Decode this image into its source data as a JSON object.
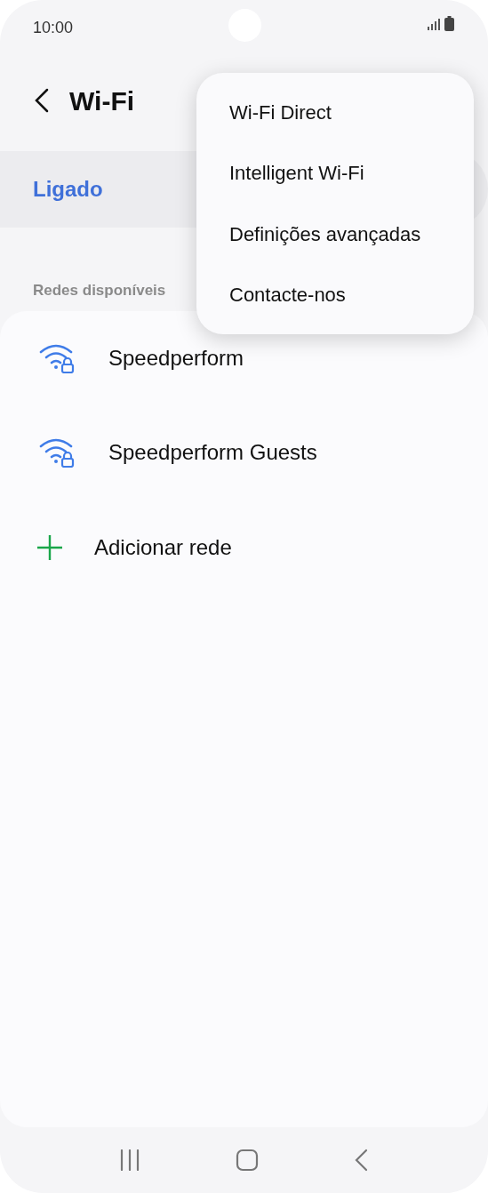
{
  "status_bar": {
    "time": "10:00"
  },
  "header": {
    "title": "Wi-Fi"
  },
  "master_switch": {
    "label": "Ligado"
  },
  "section_label": "Redes disponíveis",
  "networks": [
    {
      "name": "Speedperform",
      "secured": true
    },
    {
      "name": "Speedperform Guests",
      "secured": true
    }
  ],
  "add_network": {
    "label": "Adicionar rede"
  },
  "menu": {
    "items": [
      {
        "label": "Wi-Fi Direct"
      },
      {
        "label": "Intelligent Wi-Fi"
      },
      {
        "label": "Definições avançadas"
      },
      {
        "label": "Contacte-nos"
      }
    ]
  }
}
